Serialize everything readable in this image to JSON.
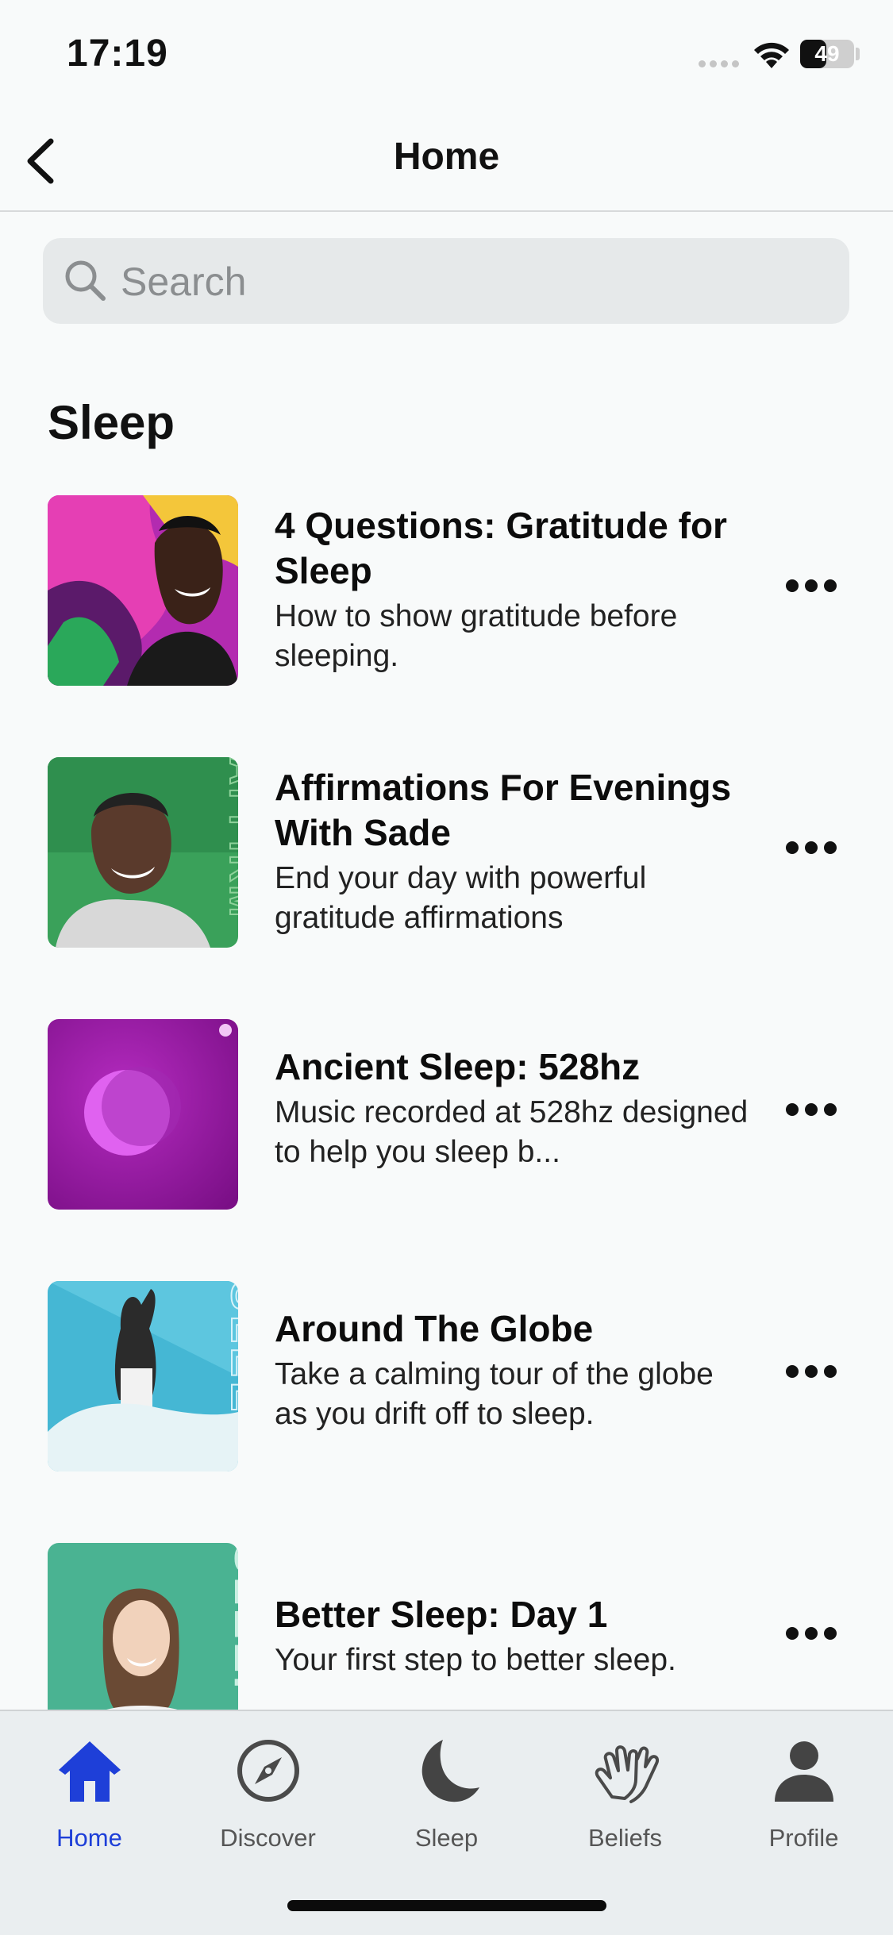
{
  "status_bar": {
    "time": "17:19",
    "battery": "49",
    "battery_level": 0.49
  },
  "nav": {
    "title": "Home"
  },
  "search": {
    "placeholder": "Search"
  },
  "section": {
    "title": "Sleep",
    "items": [
      {
        "title": "4 Questions: Gratitude for Sleep",
        "subtitle": "How to show gratitude before sleeping."
      },
      {
        "title": "Affirmations For Evenings With Sade",
        "subtitle": "End your day with powerful gratitude affirmations"
      },
      {
        "title": "Ancient Sleep: 528hz",
        "subtitle": "Music recorded at 528hz designed to help you sleep b..."
      },
      {
        "title": "Around The Globe",
        "subtitle": "Take a calming tour of the globe as you drift off to sleep."
      },
      {
        "title": "Better Sleep: Day 1",
        "subtitle": "Your first step to better sleep."
      }
    ]
  },
  "thumb_text": {
    "affirm": "AFFIRM",
    "sleep": "SLEEP"
  },
  "tabs": [
    {
      "label": "Home",
      "icon": "home-icon",
      "active": true
    },
    {
      "label": "Discover",
      "icon": "compass-icon"
    },
    {
      "label": "Sleep",
      "icon": "moon-icon"
    },
    {
      "label": "Beliefs",
      "icon": "hands-icon"
    },
    {
      "label": "Profile",
      "icon": "person-icon"
    }
  ],
  "colors": {
    "accent": "#1e3fd8",
    "tab_inactive": "#555555",
    "background": "#f8fafa"
  }
}
